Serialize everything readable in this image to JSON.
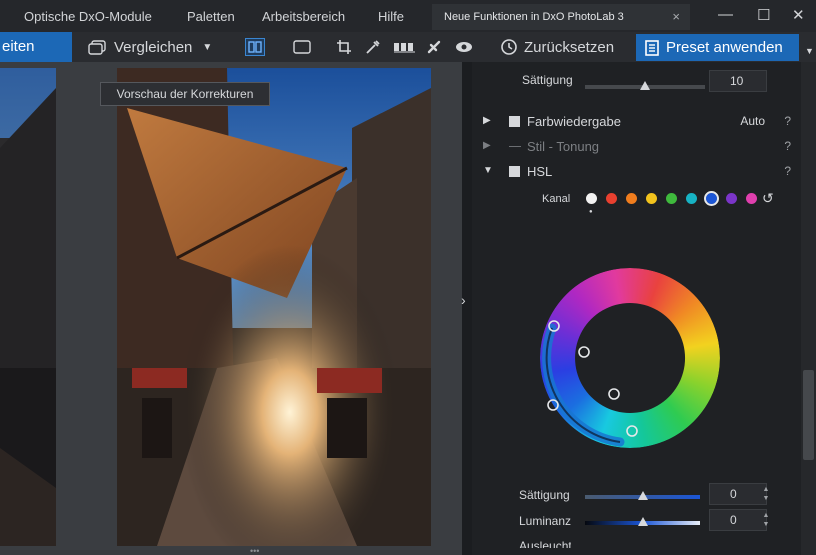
{
  "menubar": {
    "items": [
      "Optische DxO-Module",
      "Paletten",
      "Arbeitsbereich",
      "Hilfe"
    ],
    "doc_tab": "Neue Funktionen in DxO PhotoLab 3",
    "close_glyph": "×",
    "window_controls": [
      "—",
      "☐",
      "✕"
    ]
  },
  "toolbar": {
    "left_tab": "eiten",
    "compare": "Vergleichen",
    "reset": "Zurücksetzen",
    "apply_preset": "Preset anwenden"
  },
  "viewer": {
    "tooltip": "Vorschau der Korrekturen",
    "collapse_glyph": "›"
  },
  "panel": {
    "saturation_top": {
      "label": "Sättigung",
      "value": "10",
      "level": 0.5
    },
    "sections": [
      {
        "title": "Farbwiedergabe",
        "value": "Auto",
        "help": "?",
        "expanded": false,
        "enabled": true
      },
      {
        "title": "Stil - Tonung",
        "value": "",
        "help": "?",
        "expanded": false,
        "enabled": false
      },
      {
        "title": "HSL",
        "value": "",
        "help": "?",
        "expanded": true,
        "enabled": true
      }
    ],
    "channel_label": "Kanal",
    "channels": [
      {
        "name": "all",
        "color": "#f2f2f2"
      },
      {
        "name": "red",
        "color": "#e8402f"
      },
      {
        "name": "orange",
        "color": "#f07d1e"
      },
      {
        "name": "yellow",
        "color": "#f2c31d"
      },
      {
        "name": "green",
        "color": "#3fba3d"
      },
      {
        "name": "cyan",
        "color": "#17b3c4"
      },
      {
        "name": "blue",
        "color": "#1b56d6",
        "selected": true
      },
      {
        "name": "purple",
        "color": "#7b35c9"
      },
      {
        "name": "magenta",
        "color": "#e03fae"
      }
    ],
    "saturation": {
      "label": "Sättigung",
      "value": "0",
      "level": 0.5
    },
    "luminance": {
      "label": "Luminanz",
      "value": "0",
      "level": 0.5
    },
    "partial_label": "Ausleuchtung"
  },
  "colors": {
    "accent": "#1c68b6",
    "panel_bg": "#1f2124",
    "toolbar_bg": "#2a2c30"
  }
}
